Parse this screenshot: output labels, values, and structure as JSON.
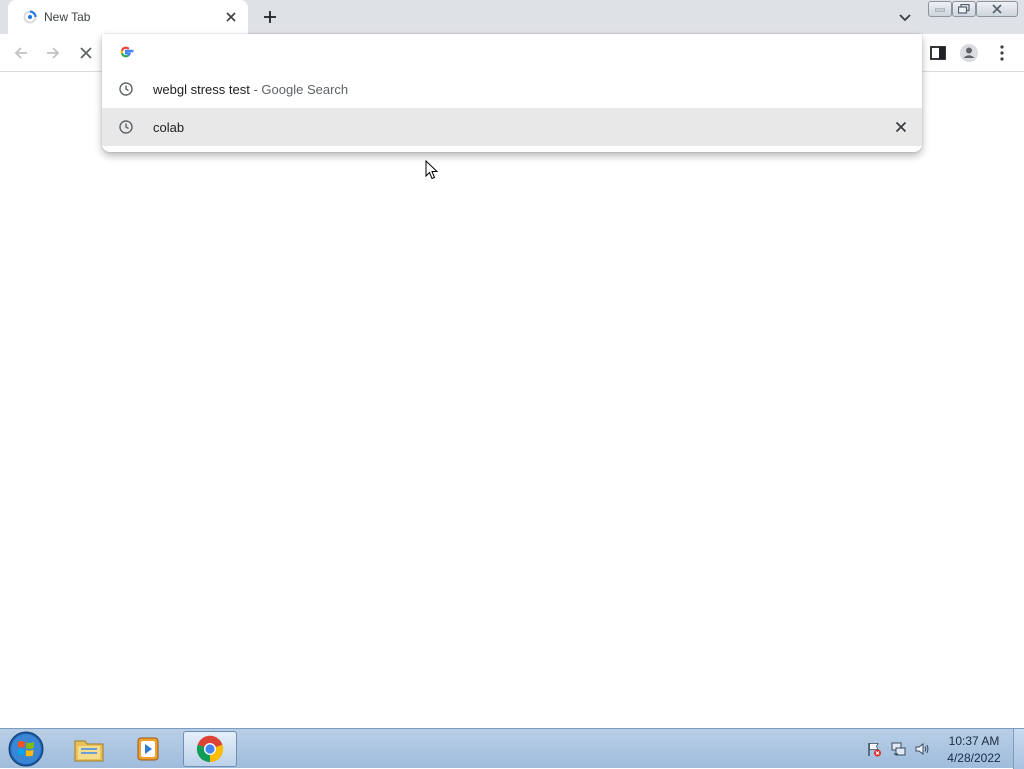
{
  "browser": {
    "tab": {
      "title": "New Tab",
      "favicon": "loading-favicon-icon",
      "close_icon": "close-icon"
    },
    "new_tab_icon": "plus-icon",
    "tab_search_icon": "chevron-down-icon",
    "window_controls": [
      "minimize-icon",
      "restore-icon",
      "close-icon"
    ]
  },
  "toolbar": {
    "icons": [
      "back-arrow-icon",
      "forward-arrow-icon",
      "stop-loading-icon",
      "side-panel-icon",
      "profile-icon",
      "more-menu-icon"
    ]
  },
  "omnibox": {
    "value": "",
    "placeholder": "",
    "logo": "google-g-icon",
    "suggestions": [
      {
        "text": "webgl stress test",
        "separator": "-",
        "sub": "Google Search",
        "icon": "history-clock-icon"
      },
      {
        "text": "colab",
        "icon": "history-clock-icon",
        "remove_icon": "close-icon"
      }
    ]
  },
  "taskbar": {
    "apps": [
      "windows-explorer-icon",
      "media-player-icon",
      "chrome-icon"
    ],
    "tray": [
      "action-center-flag-icon",
      "network-icon",
      "volume-icon"
    ],
    "time": "10:37 AM",
    "date": "4/28/2022"
  },
  "colors": {
    "tabstrip": "#dee1e6",
    "selected_suggestion": "#e8e8e9",
    "taskbar": "#b9cfe6"
  }
}
